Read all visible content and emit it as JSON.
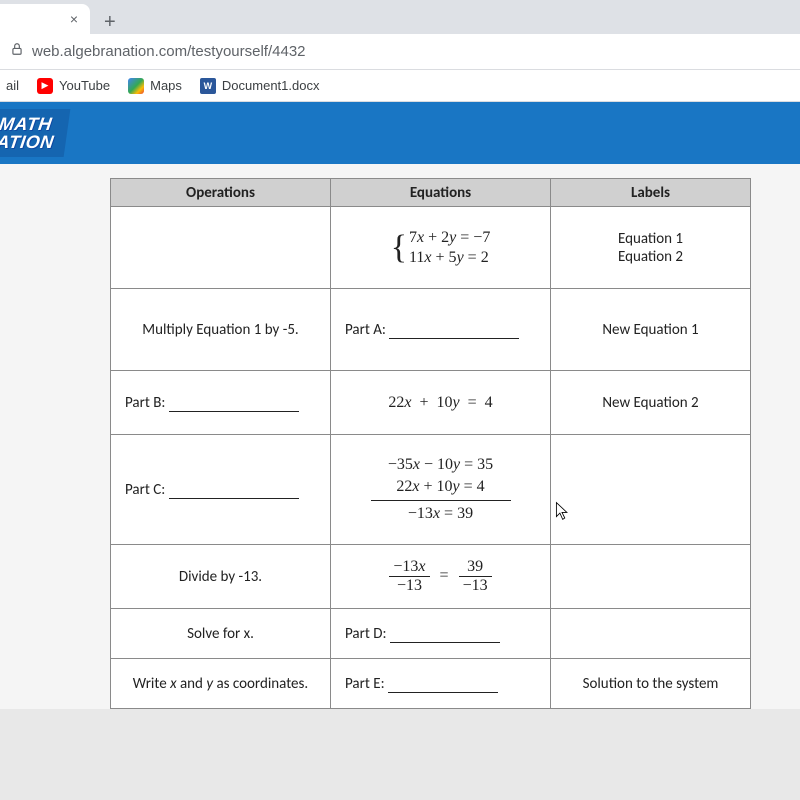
{
  "browser": {
    "url": "web.algebranation.com/testyourself/4432",
    "bookmarks": [
      {
        "label": "ail"
      },
      {
        "label": "YouTube"
      },
      {
        "label": "Maps"
      },
      {
        "label": "Document1.docx"
      }
    ]
  },
  "logo": {
    "line1": "MATH",
    "line2": "ATION"
  },
  "table": {
    "headers": {
      "operations": "Operations",
      "equations": "Equations",
      "labels": "Labels"
    },
    "rows": [
      {
        "op": "",
        "eq": {
          "type": "system",
          "lines": [
            "7x + 2y = −7",
            "11x + 5y = 2"
          ]
        },
        "label_lines": [
          "Equation 1",
          "Equation 2"
        ]
      },
      {
        "op": "Multiply Equation 1 by -5.",
        "eq": {
          "type": "blank",
          "prefix": "Part A:"
        },
        "label": "New Equation 1"
      },
      {
        "op_blank_prefix": "Part B:",
        "eq": {
          "type": "plain",
          "text": "22x + 10y = 4"
        },
        "label": "New Equation 2"
      },
      {
        "op_blank_prefix": "Part C:",
        "eq": {
          "type": "addition",
          "lines": [
            "−35x − 10y = 35",
            "22x + 10y = 4"
          ],
          "result": "−13x = 39"
        },
        "label": ""
      },
      {
        "op": "Divide by -13.",
        "eq": {
          "type": "fraction_eq",
          "left_num": "−13x",
          "left_den": "−13",
          "right_num": "39",
          "right_den": "−13"
        },
        "label": ""
      },
      {
        "op": "Solve for x.",
        "eq": {
          "type": "blank",
          "prefix": "Part D:"
        },
        "label": ""
      },
      {
        "op": "Write x and y as coordinates.",
        "eq": {
          "type": "blank",
          "prefix": "Part E:"
        },
        "label": "Solution to the system"
      }
    ]
  },
  "chart_data": {
    "type": "table",
    "title": "Solving a system by elimination",
    "columns": [
      "Operations",
      "Equations",
      "Labels"
    ],
    "rows": [
      [
        "",
        "{ 7x + 2y = -7 ; 11x + 5y = 2 }",
        "Equation 1 / Equation 2"
      ],
      [
        "Multiply Equation 1 by -5.",
        "Part A: ____",
        "New Equation 1"
      ],
      [
        "Part B: ____",
        "22x + 10y = 4",
        "New Equation 2"
      ],
      [
        "Part C: ____",
        "-35x - 10y = 35 ; 22x + 10y = 4 ; sum: -13x = 39",
        ""
      ],
      [
        "Divide by -13.",
        "(-13x)/(-13) = 39/(-13)",
        ""
      ],
      [
        "Solve for x.",
        "Part D: ____",
        ""
      ],
      [
        "Write x and y as coordinates.",
        "Part E: ____",
        "Solution to the system"
      ]
    ]
  }
}
